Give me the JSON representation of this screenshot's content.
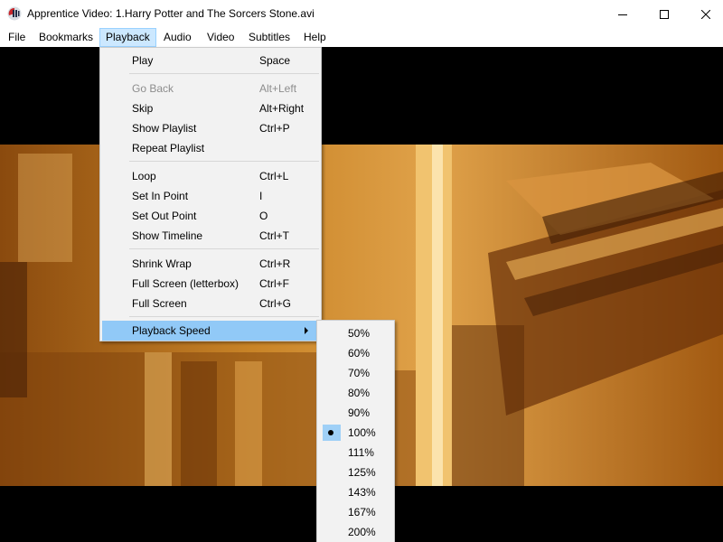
{
  "window": {
    "title": "Apprentice Video: 1.Harry Potter and The Sorcers Stone.avi",
    "icon": "apprentice-video-app-icon",
    "controls": [
      "minimize-icon",
      "maximize-icon",
      "close-icon"
    ]
  },
  "menubar": {
    "items": [
      {
        "label": "File"
      },
      {
        "label": "Bookmarks"
      },
      {
        "label": "Playback",
        "active": true
      },
      {
        "label": "Audio"
      },
      {
        "label": "Video"
      },
      {
        "label": "Subtitles"
      },
      {
        "label": "Help"
      }
    ]
  },
  "playback_menu": {
    "items": [
      {
        "label": "Play",
        "shortcut": "Space"
      },
      {
        "label": "Go Back",
        "shortcut": "Alt+Left",
        "disabled": true
      },
      {
        "label": "Skip",
        "shortcut": "Alt+Right"
      },
      {
        "label": "Show Playlist",
        "shortcut": "Ctrl+P"
      },
      {
        "label": "Repeat Playlist",
        "shortcut": ""
      },
      {
        "label": "Loop",
        "shortcut": "Ctrl+L"
      },
      {
        "label": "Set In Point",
        "shortcut": "I"
      },
      {
        "label": "Set Out Point",
        "shortcut": "O"
      },
      {
        "label": "Show Timeline",
        "shortcut": "Ctrl+T"
      },
      {
        "label": "Shrink Wrap",
        "shortcut": "Ctrl+R"
      },
      {
        "label": "Full Screen (letterbox)",
        "shortcut": "Ctrl+F"
      },
      {
        "label": "Full Screen",
        "shortcut": "Ctrl+G"
      },
      {
        "label": "Playback Speed",
        "shortcut": "",
        "submenu": true,
        "highlighted": true
      }
    ]
  },
  "speed_menu": {
    "options": [
      "50%",
      "60%",
      "70%",
      "80%",
      "90%",
      "100%",
      "111%",
      "125%",
      "143%",
      "167%",
      "200%"
    ],
    "selected": "100%"
  },
  "colors": {
    "highlight": "#91c9f7",
    "menu_background": "#f2f2f2",
    "menubar_active": "#cce8ff",
    "video_tone": "#c97a1c"
  }
}
